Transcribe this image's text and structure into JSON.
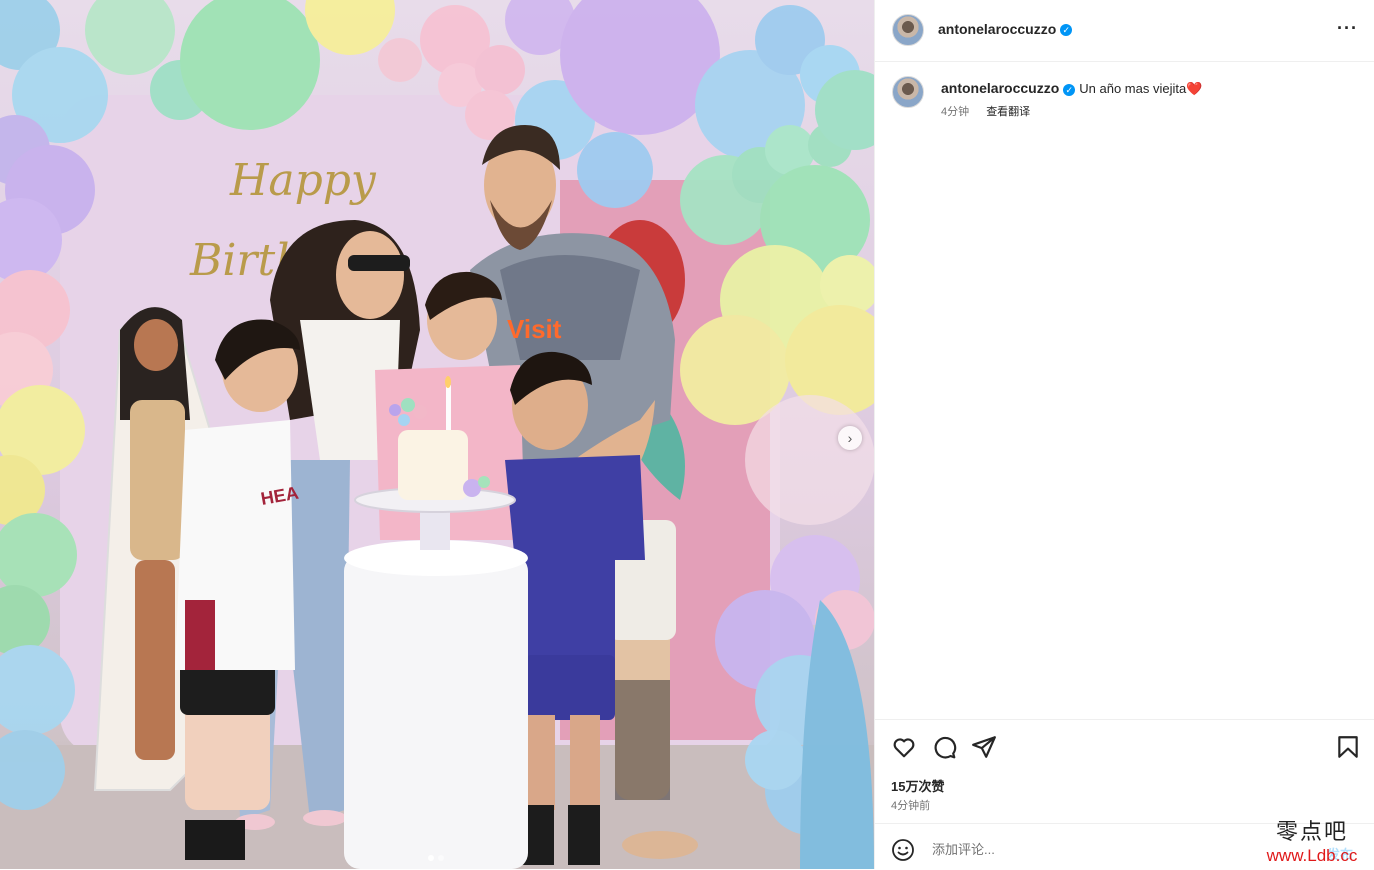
{
  "post": {
    "username": "antonelaroccuzzo",
    "verified_mark": "✓",
    "more_label": "···"
  },
  "photo": {
    "banner_line1": "Happy",
    "banner_line2": "Birthd",
    "shirt_text": "Inter Miami - Visit",
    "carousel_next": "›",
    "carousel_count": 2,
    "carousel_active": 1
  },
  "caption": {
    "username": "antonelaroccuzzo",
    "text": "Un año mas viejita",
    "emoji": "❤️",
    "time": "4分钟",
    "translate": "查看翻译"
  },
  "actions": {
    "icons": [
      "heart-icon",
      "comment-icon",
      "share-icon",
      "bookmark-icon"
    ],
    "likes": "15万次赞",
    "time_ago": "4分钟前"
  },
  "comment": {
    "placeholder": "添加评论...",
    "post_label": "发布"
  },
  "watermark": {
    "line1": "零点吧",
    "line2": "www.Ldb.cc"
  },
  "colors": {
    "accent": "#0095f6",
    "text": "#262626",
    "muted": "#737373",
    "border": "#efefef"
  }
}
